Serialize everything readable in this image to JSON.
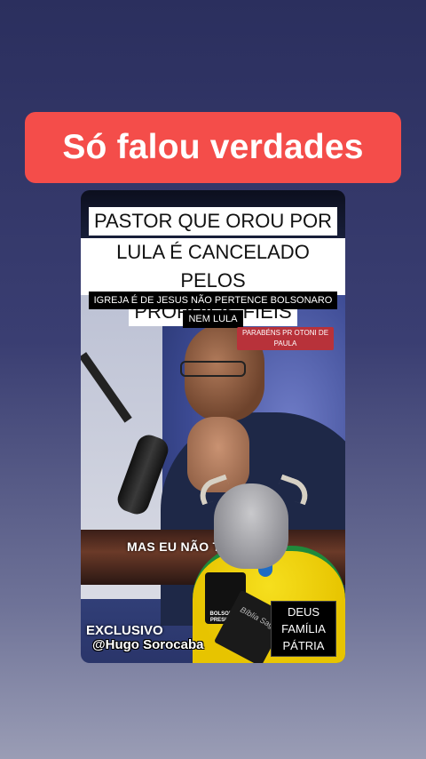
{
  "banner": {
    "text": "Só falou verdades"
  },
  "video": {
    "title_lines": [
      "PASTOR QUE OROU POR",
      "LULA É CANCELADO PELOS",
      "PRÓPRIOS FIÉIS"
    ],
    "subtitle_lines": [
      "IGREJA É DE JESUS NÃO PERTENCE BOLSONARO",
      "NEM LULA"
    ],
    "red_tag": "PARABÉNS PR OTONI DE PAULA",
    "caption": "MAS EU NÃO TÔ NE",
    "badge_text": "BOLSONARO PRESIDENTE",
    "bible_text": "Bíblia Sagrada",
    "stamp_lines": [
      "DEUS",
      "FAMÍLIA",
      "PÁTRIA"
    ],
    "exclusive": "EXCLUSIVO",
    "handle": "@Hugo Sorocaba"
  },
  "colors": {
    "banner": "#f44d4a",
    "tag": "#b8323a",
    "shirt": "#e7c400"
  }
}
